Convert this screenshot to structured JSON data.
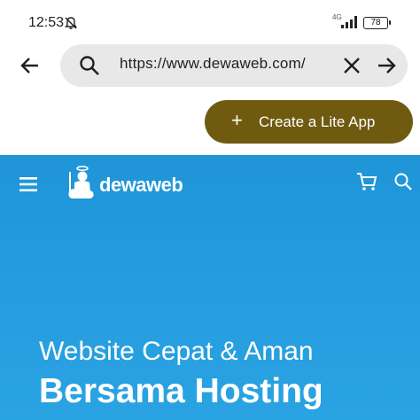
{
  "status_bar": {
    "time": "12:53",
    "network": "4G",
    "battery": "78"
  },
  "browser": {
    "url": "https://www.dewaweb.com/",
    "create_app_label": "Create a Lite App",
    "create_app_icon": "plus-icon"
  },
  "website": {
    "logo_text": "dewaweb",
    "hero_subtitle": "Website Cepat & Aman",
    "hero_title": "Bersama Hosting",
    "background_color": "#1f95d8"
  },
  "colors": {
    "accent_button": "#6f5a10",
    "url_bar": "#e8e8e8"
  }
}
